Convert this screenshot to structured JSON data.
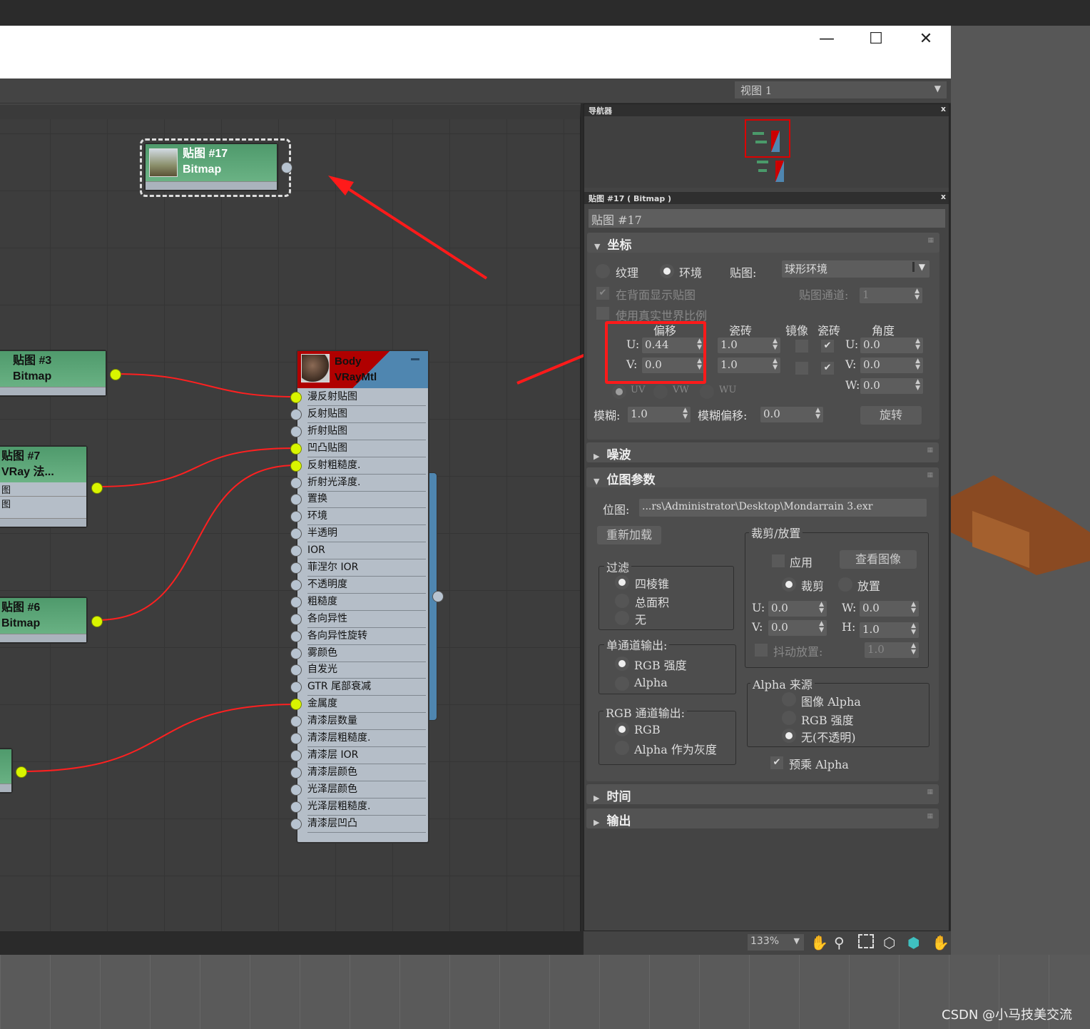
{
  "window": {
    "minimize_icon": "minimize-icon",
    "maximize_icon": "maximize-icon",
    "close_icon": "close-icon"
  },
  "toolbar": {
    "view_select": "视图 1"
  },
  "nodes": {
    "map17": {
      "title": "贴图 #17",
      "type": "Bitmap"
    },
    "map3": {
      "title": "贴图 #3",
      "type": "Bitmap"
    },
    "map7": {
      "title": "贴图 #7",
      "type": "VRay 法...",
      "rows": [
        "图",
        "图"
      ]
    },
    "map6": {
      "title": "贴图 #6",
      "type": "Bitmap"
    },
    "material": {
      "title": "Body",
      "type": "VRayMtl",
      "slots": [
        "漫反射贴图",
        "反射贴图",
        "折射贴图",
        "凹凸贴图",
        "反射粗糙度.",
        "折射光泽度.",
        "置换",
        "环境",
        "半透明",
        "IOR",
        "菲涅尔 IOR",
        "不透明度",
        "粗糙度",
        "各向异性",
        "各向异性旋转",
        "雾颜色",
        "自发光",
        "GTR 尾部衰减",
        "金属度",
        "清漆层数量",
        "清漆层粗糙度.",
        "清漆层 IOR",
        "清漆层颜色",
        "光泽层颜色",
        "光泽层粗糙度.",
        "清漆层凹凸"
      ],
      "connected_slots": [
        0,
        3,
        4,
        18
      ]
    }
  },
  "navigator": {
    "title": "导航器"
  },
  "params": {
    "title": "贴图 #17 ( Bitmap )",
    "name": "贴图 #17",
    "coords": {
      "header": "坐标",
      "texture": "纹理",
      "environ": "环境",
      "mapping_label": "贴图:",
      "mapping_value": "球形环境",
      "show_back": "在背面显示贴图",
      "map_channel_label": "贴图通道:",
      "map_channel": "1",
      "real_world": "使用真实世界比例",
      "offset": "偏移",
      "tiling": "瓷砖",
      "mirror": "镜像",
      "tile": "瓷砖",
      "angle": "角度",
      "u": "U:",
      "v": "V:",
      "w": "W:",
      "offset_u": "0.44",
      "offset_v": "0.0",
      "tiling_u": "1.0",
      "tiling_v": "1.0",
      "angle_u": "0.0",
      "angle_v": "0.0",
      "angle_w": "0.0",
      "uv": "UV",
      "vw": "VW",
      "wu": "WU",
      "blur_label": "模糊:",
      "blur": "1.0",
      "blur_offset_label": "模糊偏移:",
      "blur_offset": "0.0",
      "rotate": "旋转"
    },
    "noise": {
      "header": "噪波"
    },
    "bitmap": {
      "header": "位图参数",
      "path_label": "位图:",
      "path": "...rs\\Administrator\\Desktop\\Mondarrain 3.exr",
      "reload": "重新加载",
      "crop": {
        "title": "裁剪/放置",
        "apply": "应用",
        "view": "查看图像",
        "crop": "裁剪",
        "place": "放置",
        "u": "0.0",
        "v": "0.0",
        "w": "0.0",
        "h": "1.0",
        "jitter": "抖动放置:",
        "jitter_val": "1.0",
        "lu": "U:",
        "lv": "V:",
        "lw": "W:",
        "lh": "H:"
      },
      "filter": {
        "title": "过滤",
        "opts": [
          "四棱锥",
          "总面积",
          "无"
        ]
      },
      "mono": {
        "title": "单通道输出:",
        "opts": [
          "RGB 强度",
          "Alpha"
        ]
      },
      "rgb": {
        "title": "RGB 通道输出:",
        "opts": [
          "RGB",
          "Alpha 作为灰度"
        ]
      },
      "alpha": {
        "title": "Alpha 来源",
        "opts": [
          "图像 Alpha",
          "RGB 强度",
          "无(不透明)"
        ]
      },
      "premult": "预乘 Alpha"
    },
    "time": {
      "header": "时间"
    },
    "output": {
      "header": "输出"
    }
  },
  "bottombar": {
    "zoom": "133%"
  },
  "watermark": "CSDN @小马技美交流",
  "colors": {
    "annotation": "#ff1a1a",
    "connected_socket": "#d9f500",
    "node_green": "#5fa878",
    "mtl_header": "#b00000"
  }
}
